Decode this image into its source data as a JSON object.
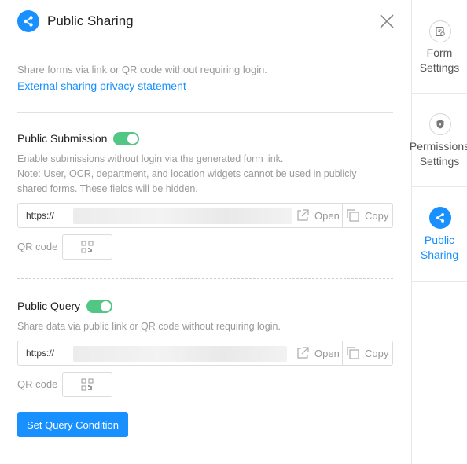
{
  "header": {
    "title": "Public Sharing"
  },
  "intro": {
    "text": "Share forms via link or QR code without requiring login.",
    "link": "External sharing privacy statement"
  },
  "submission": {
    "label": "Public Submission",
    "enabled": true,
    "desc_line1": "Enable submissions without login via the generated form link.",
    "desc_line2": "Note: User, OCR, department, and location widgets cannot be used in publicly",
    "desc_line3": "shared forms. These fields will be hidden.",
    "url_prefix": "https://",
    "open_label": "Open",
    "copy_label": "Copy",
    "qr_label": "QR code"
  },
  "query": {
    "label": "Public Query",
    "enabled": true,
    "desc": "Share data via public link or QR code without requiring login.",
    "url_prefix": "https://",
    "open_label": "Open",
    "copy_label": "Copy",
    "qr_label": "QR code",
    "condition_button": "Set Query Condition"
  },
  "sidebar": {
    "items": [
      {
        "label": "Form\nSettings",
        "icon": "form-settings-icon",
        "active": false
      },
      {
        "label": "Permissions\nSettings",
        "icon": "shield-icon",
        "active": false
      },
      {
        "label": "Public\nSharing",
        "icon": "share-icon",
        "active": true
      }
    ]
  },
  "colors": {
    "accent": "#1890ff",
    "toggle_on": "#52c785",
    "muted_text": "#9a9a9a"
  }
}
